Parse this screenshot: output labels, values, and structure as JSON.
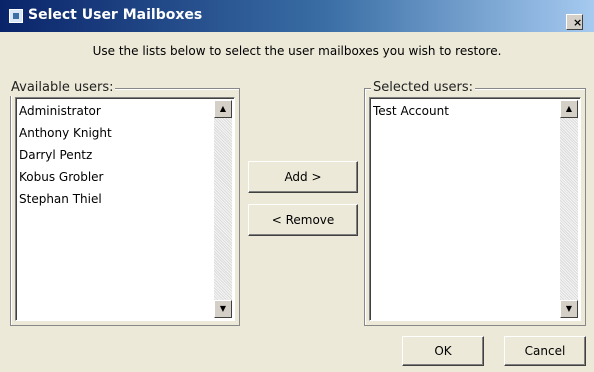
{
  "window": {
    "title": "Select User Mailboxes",
    "close_glyph": "×"
  },
  "instruction": "Use the lists below to select the user mailboxes you wish to restore.",
  "available": {
    "label": "Available users:",
    "items": [
      "Administrator",
      "Anthony Knight",
      "Darryl Pentz",
      "Kobus Grobler",
      "Stephan Thiel"
    ]
  },
  "selected": {
    "label": "Selected users:",
    "items": [
      "Test Account"
    ]
  },
  "buttons": {
    "add": "Add >",
    "remove": "< Remove",
    "ok": "OK",
    "cancel": "Cancel"
  },
  "icons": {
    "scroll_up": "▲",
    "scroll_down": "▼",
    "app": "app-icon"
  },
  "colors": {
    "title_gradient_start": "#0a246a",
    "title_gradient_end": "#a6caf0",
    "dialog_bg": "#ece9d8"
  }
}
